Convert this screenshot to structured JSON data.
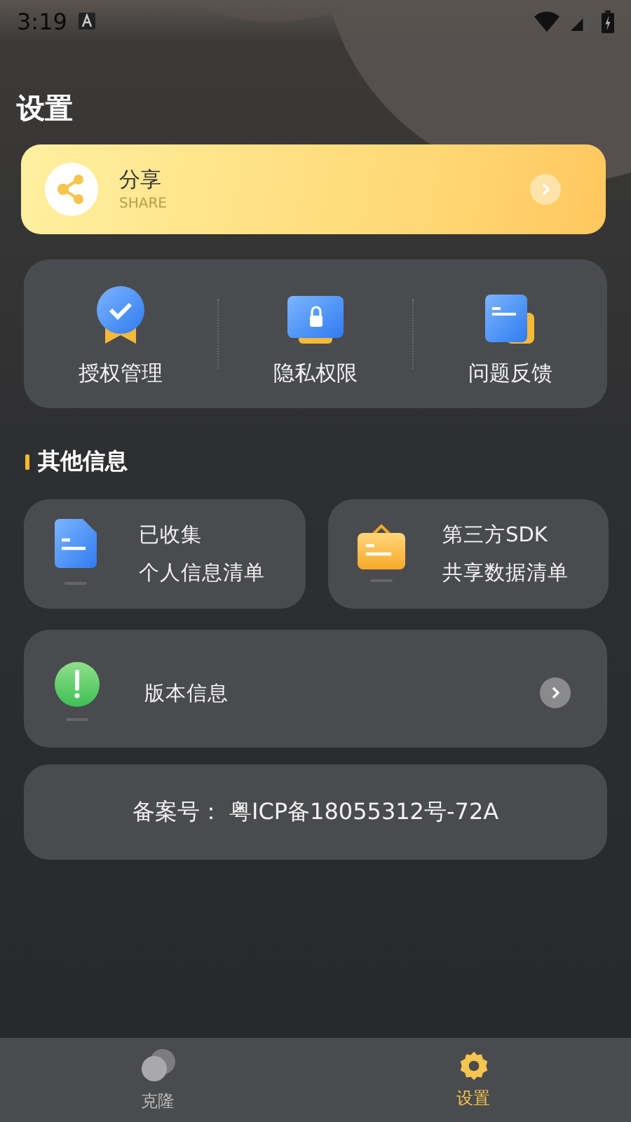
{
  "status_bar": {
    "time": "3:19"
  },
  "title": "设置",
  "share": {
    "title": "分享",
    "subtitle": "SHARE"
  },
  "quick_actions": [
    {
      "label": "授权管理",
      "kind": "badge"
    },
    {
      "label": "隐私权限",
      "kind": "lock"
    },
    {
      "label": "问题反馈",
      "kind": "doc"
    }
  ],
  "section": {
    "title": "其他信息"
  },
  "info_cards": [
    {
      "kind": "file",
      "lines": [
        "已收集",
        "个人信息清单"
      ]
    },
    {
      "kind": "bag",
      "lines": [
        "第三方SDK",
        "共享数据清单"
      ]
    }
  ],
  "version": {
    "label": "版本信息"
  },
  "icp": {
    "text": "备案号： 粤ICP备18055312号-72A"
  },
  "bottom_nav": [
    {
      "label": "克隆",
      "kind": "clone",
      "selected": false
    },
    {
      "label": "设置",
      "kind": "gear",
      "selected": true
    }
  ]
}
